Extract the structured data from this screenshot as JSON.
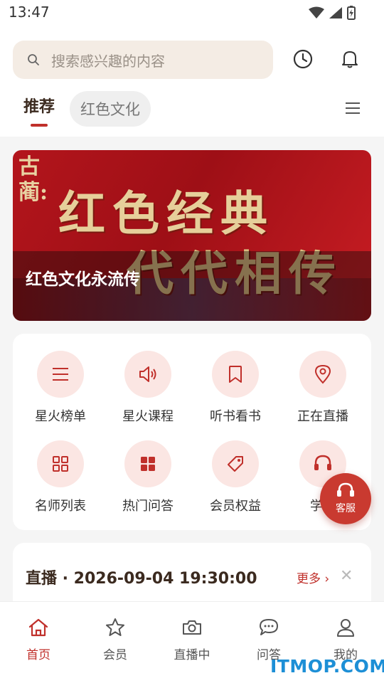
{
  "status_bar": {
    "time": "13:47",
    "icons": [
      "wifi-icon",
      "signal-icon",
      "battery-icon"
    ]
  },
  "search": {
    "placeholder": "搜索感兴趣的内容"
  },
  "header_icons": [
    "history-clock-icon",
    "bell-icon"
  ],
  "tabs": {
    "active": "推荐",
    "secondary": "红色文化"
  },
  "banner": {
    "small_text": "古蔺:",
    "big_line1": "红色经典",
    "big_line2": "代代相传",
    "caption": "红色文化永流传"
  },
  "grid": [
    {
      "label": "星火榜单",
      "icon": "list-icon"
    },
    {
      "label": "星火课程",
      "icon": "speaker-icon"
    },
    {
      "label": "听书看书",
      "icon": "bookmark-icon"
    },
    {
      "label": "正在直播",
      "icon": "location-pin-icon"
    },
    {
      "label": "名师列表",
      "icon": "grid-outline-icon"
    },
    {
      "label": "热门问答",
      "icon": "grid-filled-icon"
    },
    {
      "label": "会员权益",
      "icon": "tag-icon"
    },
    {
      "label": "学习",
      "icon": "headset-icon"
    }
  ],
  "live": {
    "title": "直播 · 2026-09-04 19:30:00",
    "more": "更多 ›",
    "close": "✕"
  },
  "fab": {
    "label": "客服",
    "icon": "headset-icon"
  },
  "bottom_nav": [
    {
      "label": "首页",
      "icon": "home-icon",
      "active": true
    },
    {
      "label": "会员",
      "icon": "star-icon",
      "active": false
    },
    {
      "label": "直播中",
      "icon": "camera-icon",
      "active": false
    },
    {
      "label": "问答",
      "icon": "chat-bubble-icon",
      "active": false
    },
    {
      "label": "我的",
      "icon": "user-icon",
      "active": false
    }
  ],
  "watermark": "ITMOP.COM",
  "colors": {
    "accent": "#c0302b",
    "icon_bg": "#fbe6e3",
    "search_bg": "#f4ece4"
  }
}
